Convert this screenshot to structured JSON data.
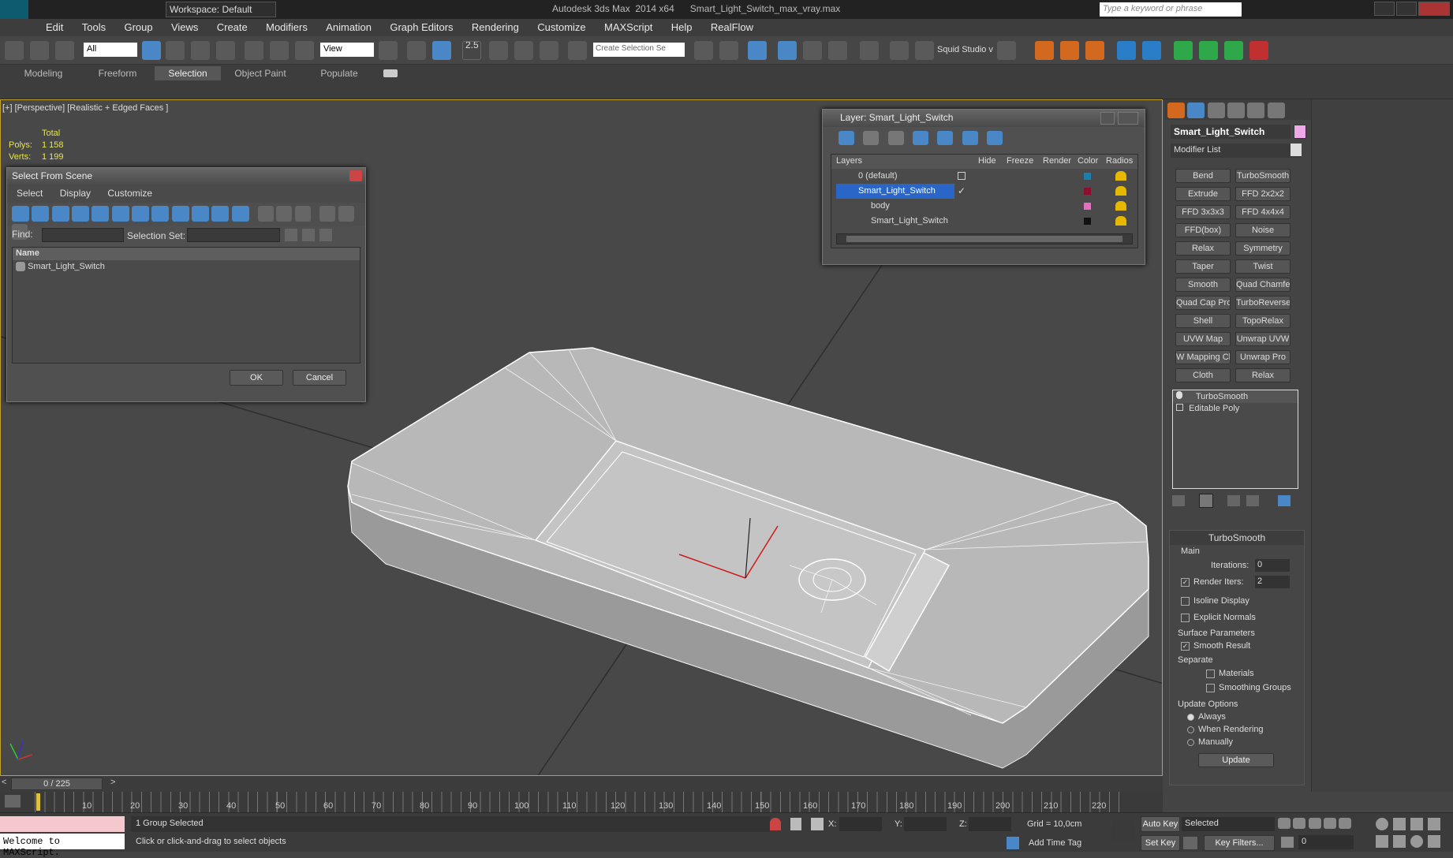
{
  "app": {
    "title": "Autodesk 3ds Max  2014 x64      Smart_Light_Switch_max_vray.max",
    "workspace": "Workspace: Default",
    "search_placeholder": "Type a keyword or phrase"
  },
  "menu": [
    "Edit",
    "Tools",
    "Group",
    "Views",
    "Create",
    "Modifiers",
    "Animation",
    "Graph Editors",
    "Rendering",
    "Customize",
    "MAXScript",
    "Help",
    "RealFlow"
  ],
  "toolbar": {
    "filter": "All",
    "view": "View",
    "snap_value": "2.5",
    "selection_set_placeholder": "Create Selection Se",
    "studio_label": "Squid Studio v"
  },
  "ribbon_tabs": [
    "Modeling",
    "Freeform",
    "Selection",
    "Object Paint",
    "Populate"
  ],
  "viewport": {
    "label": "[+] [Perspective] [Realistic + Edged Faces ]",
    "stats": {
      "total_label": "Total",
      "polys_label": "Polys:",
      "polys_value": "1 158",
      "verts_label": "Verts:",
      "verts_value": "1 199"
    }
  },
  "select_dialog": {
    "title": "Select From Scene",
    "menu": [
      "Select",
      "Display",
      "Customize"
    ],
    "find_label": "Find:",
    "selection_set_label": "Selection Set:",
    "column_name": "Name",
    "items": [
      "Smart_Light_Switch"
    ],
    "ok": "OK",
    "cancel": "Cancel"
  },
  "layer_dialog": {
    "title": "Layer: Smart_Light_Switch",
    "columns": [
      "Layers",
      "Hide",
      "Freeze",
      "Render",
      "Color",
      "Radios"
    ],
    "rows": [
      {
        "name": "0 (default)",
        "color": "#1a7fae",
        "selected": false,
        "indent": 0
      },
      {
        "name": "Smart_Light_Switch",
        "color": "#8a1030",
        "selected": true,
        "indent": 0
      },
      {
        "name": "body",
        "color": "#e070c0",
        "selected": false,
        "indent": 1
      },
      {
        "name": "Smart_Light_Switch",
        "color": "#111111",
        "selected": false,
        "indent": 1
      }
    ]
  },
  "command_panel": {
    "object_name": "Smart_Light_Switch",
    "modifier_list": "Modifier List",
    "buttons": [
      [
        "Bend",
        "TurboSmooth"
      ],
      [
        "Extrude",
        "FFD 2x2x2"
      ],
      [
        "FFD 3x3x3",
        "FFD 4x4x4"
      ],
      [
        "FFD(box)",
        "Noise"
      ],
      [
        "Relax",
        "Symmetry"
      ],
      [
        "Taper",
        "Twist"
      ],
      [
        "Smooth",
        "Quad Chamfer"
      ],
      [
        "Quad Cap Pro",
        "TurboReverse"
      ],
      [
        "Shell",
        "TopoRelax"
      ],
      [
        "UVW Map",
        "Unwrap UVW"
      ],
      [
        "W Mapping Cle",
        "Unwrap Pro"
      ],
      [
        "Cloth",
        "Relax"
      ]
    ],
    "stack": [
      "TurboSmooth",
      "Editable Poly"
    ],
    "rollout_title": "TurboSmooth",
    "main_label": "Main",
    "iterations_label": "Iterations:",
    "iterations_value": "0",
    "render_iters_label": "Render Iters:",
    "render_iters_value": "2",
    "isoline": "Isoline Display",
    "explicit_normals": "Explicit Normals",
    "surface_params": "Surface Parameters",
    "smooth_result": "Smooth Result",
    "separate": "Separate",
    "materials": "Materials",
    "smoothing_groups": "Smoothing Groups",
    "update_options": "Update Options",
    "always": "Always",
    "when_rendering": "When Rendering",
    "manually": "Manually",
    "update": "Update"
  },
  "timeline": {
    "frame": "0 / 225",
    "ticks": [
      "10",
      "20",
      "30",
      "40",
      "50",
      "60",
      "70",
      "80",
      "90",
      "100",
      "110",
      "120",
      "130",
      "140",
      "150",
      "160",
      "170",
      "180",
      "190",
      "200",
      "210",
      "220"
    ]
  },
  "status": {
    "maxscript": "Welcome to MAXScript.",
    "selection": "1 Group Selected",
    "prompt": "Click or click-and-drag to select objects",
    "x_label": "X:",
    "y_label": "Y:",
    "z_label": "Z:",
    "grid": "Grid = 10,0cm",
    "add_time_tag": "Add Time Tag",
    "auto_key": "Auto Key",
    "set_key": "Set Key",
    "key_mode": "Selected",
    "key_filters": "Key Filters...",
    "frame_value": "0"
  }
}
